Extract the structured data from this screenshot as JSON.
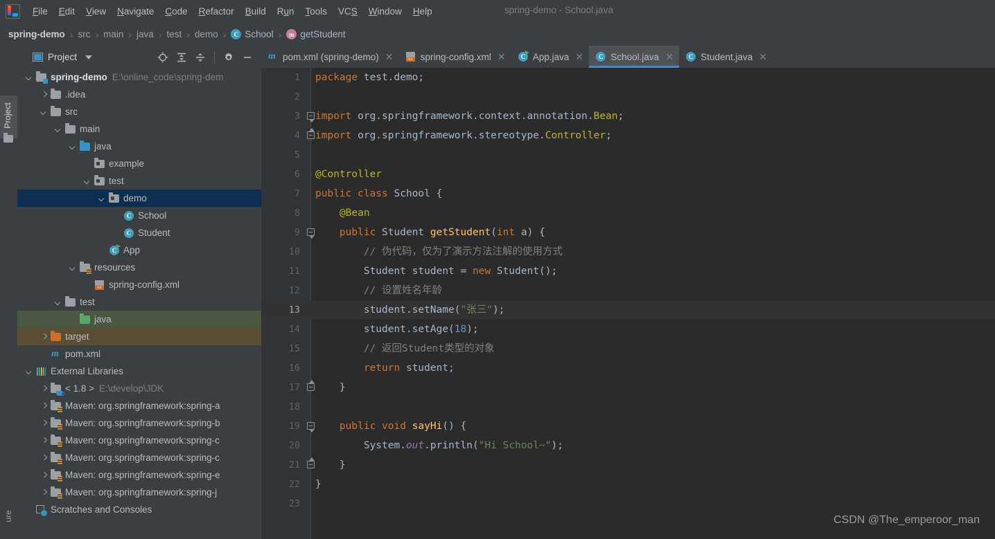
{
  "window": {
    "title": "spring-demo - School.java",
    "logo_icon": "intellij-idea-logo"
  },
  "menubar": {
    "items": [
      {
        "label": "File",
        "mnemonic": "F"
      },
      {
        "label": "Edit",
        "mnemonic": "E"
      },
      {
        "label": "View",
        "mnemonic": "V"
      },
      {
        "label": "Navigate",
        "mnemonic": "N"
      },
      {
        "label": "Code",
        "mnemonic": "C"
      },
      {
        "label": "Refactor",
        "mnemonic": "R"
      },
      {
        "label": "Build",
        "mnemonic": "B"
      },
      {
        "label": "Run",
        "mnemonic": "u"
      },
      {
        "label": "Tools",
        "mnemonic": "T"
      },
      {
        "label": "VCS",
        "mnemonic": "S"
      },
      {
        "label": "Window",
        "mnemonic": "W"
      },
      {
        "label": "Help",
        "mnemonic": "H"
      }
    ]
  },
  "breadcrumb": {
    "items": [
      {
        "label": "spring-demo",
        "icon": "none",
        "style": "bold"
      },
      {
        "label": "src",
        "icon": "none",
        "style": "dim"
      },
      {
        "label": "main",
        "icon": "none",
        "style": "dim"
      },
      {
        "label": "java",
        "icon": "none",
        "style": "dim"
      },
      {
        "label": "test",
        "icon": "none",
        "style": "dim"
      },
      {
        "label": "demo",
        "icon": "none",
        "style": "dim"
      },
      {
        "label": "School",
        "icon": "class-icon",
        "icon_letter": "C",
        "style": "normal"
      },
      {
        "label": "getStudent",
        "icon": "method-icon",
        "icon_letter": "m",
        "style": "normal"
      }
    ],
    "separator": "›"
  },
  "toolstrip": {
    "project_tab": "Project",
    "project_tab_icon": "folder-icon",
    "structure_tab": "ure"
  },
  "project_panel": {
    "title": "Project",
    "title_icon": "project-view-icon",
    "dropdown_icon": "chevron-down-icon",
    "tools": [
      {
        "name": "locate-in-tree-icon",
        "title": "Select Opened File"
      },
      {
        "name": "expand-all-icon",
        "title": "Expand All"
      },
      {
        "name": "collapse-all-icon",
        "title": "Collapse All"
      },
      {
        "name": "gear-icon",
        "title": "Settings"
      },
      {
        "name": "minimize-icon",
        "title": "Hide"
      }
    ],
    "tree": [
      {
        "label": "spring-demo",
        "suffix": "E:\\online_code\\spring-dem",
        "indent": 0,
        "arrow": "down",
        "icon": "module-folder-icon",
        "bold": true,
        "row_style": "none"
      },
      {
        "label": ".idea",
        "suffix": "",
        "indent": 1,
        "arrow": "right",
        "icon": "folder-gray-icon",
        "bold": false,
        "row_style": "none"
      },
      {
        "label": "src",
        "suffix": "",
        "indent": 1,
        "arrow": "down",
        "icon": "folder-gray-icon",
        "bold": false,
        "row_style": "none"
      },
      {
        "label": "main",
        "suffix": "",
        "indent": 2,
        "arrow": "down",
        "icon": "folder-gray-icon",
        "bold": false,
        "row_style": "none"
      },
      {
        "label": "java",
        "suffix": "",
        "indent": 3,
        "arrow": "down",
        "icon": "folder-source-blue-icon",
        "bold": false,
        "row_style": "none"
      },
      {
        "label": "example",
        "suffix": "",
        "indent": 4,
        "arrow": "none",
        "icon": "package-icon",
        "bold": false,
        "row_style": "none"
      },
      {
        "label": "test",
        "suffix": "",
        "indent": 4,
        "arrow": "down",
        "icon": "package-icon",
        "bold": false,
        "row_style": "none"
      },
      {
        "label": "demo",
        "suffix": "",
        "indent": 5,
        "arrow": "down",
        "icon": "package-icon",
        "bold": false,
        "row_style": "selected"
      },
      {
        "label": "School",
        "suffix": "",
        "indent": 6,
        "arrow": "none",
        "icon": "java-class-icon",
        "bold": false,
        "row_style": "none"
      },
      {
        "label": "Student",
        "suffix": "",
        "indent": 6,
        "arrow": "none",
        "icon": "java-class-icon",
        "bold": false,
        "row_style": "none"
      },
      {
        "label": "App",
        "suffix": "",
        "indent": 5,
        "arrow": "none",
        "icon": "java-runnable-class-icon",
        "bold": false,
        "row_style": "none"
      },
      {
        "label": "resources",
        "suffix": "",
        "indent": 3,
        "arrow": "down",
        "icon": "folder-resources-icon",
        "bold": false,
        "row_style": "none"
      },
      {
        "label": "spring-config.xml",
        "suffix": "",
        "indent": 4,
        "arrow": "none",
        "icon": "xml-file-icon",
        "bold": false,
        "row_style": "none"
      },
      {
        "label": "test",
        "suffix": "",
        "indent": 2,
        "arrow": "down",
        "icon": "folder-gray-icon",
        "bold": false,
        "row_style": "none"
      },
      {
        "label": "java",
        "suffix": "",
        "indent": 3,
        "arrow": "none",
        "icon": "folder-test-green-icon",
        "bold": false,
        "row_style": "green"
      },
      {
        "label": "target",
        "suffix": "",
        "indent": 1,
        "arrow": "right",
        "icon": "folder-excluded-orange-icon",
        "bold": false,
        "row_style": "brown"
      },
      {
        "label": "pom.xml",
        "suffix": "",
        "indent": 1,
        "arrow": "none",
        "icon": "maven-pom-icon",
        "bold": false,
        "row_style": "none"
      },
      {
        "label": "External Libraries",
        "suffix": "",
        "indent": 0,
        "arrow": "down",
        "icon": "external-libraries-icon",
        "bold": false,
        "row_style": "none"
      },
      {
        "label": "< 1.8 >",
        "suffix": "E:\\develop\\JDK",
        "indent": 1,
        "arrow": "right",
        "icon": "jdk-folder-icon",
        "bold": false,
        "row_style": "none"
      },
      {
        "label": "Maven: org.springframework:spring-a",
        "suffix": "",
        "indent": 1,
        "arrow": "right",
        "icon": "library-folder-icon",
        "bold": false,
        "row_style": "none"
      },
      {
        "label": "Maven: org.springframework:spring-b",
        "suffix": "",
        "indent": 1,
        "arrow": "right",
        "icon": "library-folder-icon",
        "bold": false,
        "row_style": "none"
      },
      {
        "label": "Maven: org.springframework:spring-c",
        "suffix": "",
        "indent": 1,
        "arrow": "right",
        "icon": "library-folder-icon",
        "bold": false,
        "row_style": "none"
      },
      {
        "label": "Maven: org.springframework:spring-c",
        "suffix": "",
        "indent": 1,
        "arrow": "right",
        "icon": "library-folder-icon",
        "bold": false,
        "row_style": "none"
      },
      {
        "label": "Maven: org.springframework:spring-e",
        "suffix": "",
        "indent": 1,
        "arrow": "right",
        "icon": "library-folder-icon",
        "bold": false,
        "row_style": "none"
      },
      {
        "label": "Maven: org.springframework:spring-j",
        "suffix": "",
        "indent": 1,
        "arrow": "right",
        "icon": "library-folder-icon",
        "bold": false,
        "row_style": "none"
      },
      {
        "label": "Scratches and Consoles",
        "suffix": "",
        "indent": 0,
        "arrow": "none",
        "icon": "scratches-icon",
        "bold": false,
        "row_style": "none"
      }
    ]
  },
  "editor": {
    "tabs": [
      {
        "label": "pom.xml (spring-demo)",
        "icon": "maven-pom-icon",
        "active": false,
        "close_icon": "close-icon"
      },
      {
        "label": "spring-config.xml",
        "icon": "xml-file-icon",
        "active": false,
        "close_icon": "close-icon"
      },
      {
        "label": "App.java",
        "icon": "java-runnable-class-icon",
        "active": false,
        "close_icon": "close-icon"
      },
      {
        "label": "School.java",
        "icon": "java-class-icon",
        "active": true,
        "close_icon": "close-icon"
      },
      {
        "label": "Student.java",
        "icon": "java-class-icon",
        "active": false,
        "close_icon": "close-icon"
      }
    ],
    "caret_line": 13,
    "lines": [
      {
        "n": 1,
        "fold": "none",
        "tokens": [
          {
            "t": "package",
            "c": "kw"
          },
          {
            "t": " test.demo;",
            "c": "plain"
          }
        ]
      },
      {
        "n": 2,
        "fold": "none",
        "tokens": []
      },
      {
        "n": 3,
        "fold": "tri-down",
        "tokens": [
          {
            "t": "import",
            "c": "kw"
          },
          {
            "t": " org.springframework.context.annotation.",
            "c": "plain"
          },
          {
            "t": "Bean",
            "c": "ann"
          },
          {
            "t": ";",
            "c": "plain"
          }
        ]
      },
      {
        "n": 4,
        "fold": "tri-up",
        "tokens": [
          {
            "t": "import",
            "c": "kw"
          },
          {
            "t": " org.springframework.stereotype.",
            "c": "plain"
          },
          {
            "t": "Controller",
            "c": "ann"
          },
          {
            "t": ";",
            "c": "plain"
          }
        ]
      },
      {
        "n": 5,
        "fold": "none",
        "tokens": []
      },
      {
        "n": 6,
        "fold": "none",
        "tokens": [
          {
            "t": "@Controller",
            "c": "ann"
          }
        ]
      },
      {
        "n": 7,
        "fold": "none",
        "tokens": [
          {
            "t": "public class",
            "c": "kw"
          },
          {
            "t": " ",
            "c": "plain"
          },
          {
            "t": "School",
            "c": "cls"
          },
          {
            "t": " {",
            "c": "plain"
          }
        ]
      },
      {
        "n": 8,
        "fold": "none",
        "tokens": [
          {
            "t": "    ",
            "c": "plain"
          },
          {
            "t": "@Bean",
            "c": "ann"
          }
        ]
      },
      {
        "n": 9,
        "fold": "tri-down",
        "tokens": [
          {
            "t": "    ",
            "c": "plain"
          },
          {
            "t": "public",
            "c": "kw"
          },
          {
            "t": " ",
            "c": "plain"
          },
          {
            "t": "Student",
            "c": "plain"
          },
          {
            "t": " ",
            "c": "plain"
          },
          {
            "t": "getStudent",
            "c": "fn"
          },
          {
            "t": "(",
            "c": "plain"
          },
          {
            "t": "int",
            "c": "kw"
          },
          {
            "t": " a) {",
            "c": "plain"
          }
        ]
      },
      {
        "n": 10,
        "fold": "none",
        "tokens": [
          {
            "t": "        ",
            "c": "plain"
          },
          {
            "t": "// 伪代码，仅为了演示方法注解的使用方式",
            "c": "cmt"
          }
        ]
      },
      {
        "n": 11,
        "fold": "none",
        "tokens": [
          {
            "t": "        Student student = ",
            "c": "plain"
          },
          {
            "t": "new",
            "c": "kw"
          },
          {
            "t": " Student();",
            "c": "plain"
          }
        ]
      },
      {
        "n": 12,
        "fold": "none",
        "tokens": [
          {
            "t": "        ",
            "c": "plain"
          },
          {
            "t": "// 设置姓名年龄",
            "c": "cmt"
          }
        ]
      },
      {
        "n": 13,
        "fold": "none",
        "tokens": [
          {
            "t": "        student.setName(",
            "c": "plain"
          },
          {
            "t": "\"张三\"",
            "c": "str"
          },
          {
            "t": ");",
            "c": "plain"
          }
        ]
      },
      {
        "n": 14,
        "fold": "none",
        "tokens": [
          {
            "t": "        student.setAge(",
            "c": "plain"
          },
          {
            "t": "18",
            "c": "num"
          },
          {
            "t": ");",
            "c": "plain"
          }
        ]
      },
      {
        "n": 15,
        "fold": "none",
        "tokens": [
          {
            "t": "        ",
            "c": "plain"
          },
          {
            "t": "// 返回Student类型的对象",
            "c": "cmt"
          }
        ]
      },
      {
        "n": 16,
        "fold": "none",
        "tokens": [
          {
            "t": "        ",
            "c": "plain"
          },
          {
            "t": "return",
            "c": "kw"
          },
          {
            "t": " student;",
            "c": "plain"
          }
        ]
      },
      {
        "n": 17,
        "fold": "tri-up",
        "tokens": [
          {
            "t": "    }",
            "c": "plain"
          }
        ]
      },
      {
        "n": 18,
        "fold": "none",
        "tokens": []
      },
      {
        "n": 19,
        "fold": "tri-down",
        "tokens": [
          {
            "t": "    ",
            "c": "plain"
          },
          {
            "t": "public void",
            "c": "kw"
          },
          {
            "t": " ",
            "c": "plain"
          },
          {
            "t": "sayHi",
            "c": "fn"
          },
          {
            "t": "() {",
            "c": "plain"
          }
        ]
      },
      {
        "n": 20,
        "fold": "none",
        "tokens": [
          {
            "t": "        System.",
            "c": "plain"
          },
          {
            "t": "out",
            "c": "stat"
          },
          {
            "t": ".println(",
            "c": "plain"
          },
          {
            "t": "\"Hi School~\"",
            "c": "str"
          },
          {
            "t": ");",
            "c": "plain"
          }
        ]
      },
      {
        "n": 21,
        "fold": "tri-up",
        "tokens": [
          {
            "t": "    }",
            "c": "plain"
          }
        ]
      },
      {
        "n": 22,
        "fold": "none",
        "tokens": [
          {
            "t": "}",
            "c": "plain"
          }
        ]
      },
      {
        "n": 23,
        "fold": "none",
        "tokens": []
      }
    ]
  },
  "watermark": {
    "text": "CSDN @The_emperoor_man"
  },
  "colors": {
    "chrome_bg": "#3c3f41",
    "editor_bg": "#2b2b2b",
    "gutter_bg": "#313335",
    "selection_blue": "#0d2f4f",
    "test_green": "#4a5841",
    "excluded_brown": "#5a4f35",
    "tab_underline": "#4a88c7",
    "keyword": "#cc7832",
    "string": "#6a8759",
    "number": "#6897bb",
    "comment": "#808080",
    "annotation": "#bbb529",
    "method": "#ffc66d",
    "static_field": "#9876aa",
    "default_text": "#a9b7c6"
  }
}
